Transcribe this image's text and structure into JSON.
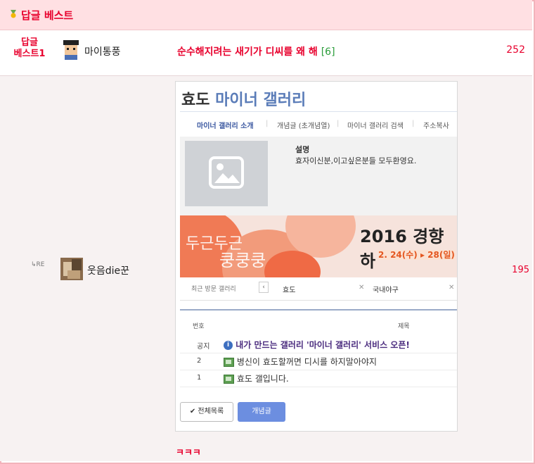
{
  "header": {
    "title": "답글 베스트"
  },
  "best_row": {
    "rank_line1": "답글",
    "rank_line2": "베스트1",
    "nickname": "마이통풍",
    "subject": "순수해지려는 새기가 디씨를 왜 해",
    "reply_count": "[6]",
    "score": "252"
  },
  "reply_row": {
    "re_label": "↳RE",
    "nickname": "웃음die꾼",
    "score": "195",
    "body_text": "ㅋㅋㅋ",
    "embedded": {
      "gallery_title_prefix": "효도",
      "gallery_title_accent": "마이너 갤러리",
      "nav": [
        "마이너 갤러리 소개",
        "개념글 (초개념열)",
        "마이너 갤러리 검색",
        "주소복사"
      ],
      "info_label": "설명",
      "info_desc": "효자이신분,이고싶은분들 모두환영요.",
      "banner_text1": "두근두근",
      "banner_text2": "쿵쿵쿵",
      "banner_title": "2016 경향하",
      "banner_dates": "2. 24(수) ▸ 28(일)",
      "recent_label": "최근 방문 갤러리",
      "recent_items": [
        "효도",
        "국내야구"
      ],
      "table_headers": [
        "번호",
        "제목"
      ],
      "rows": [
        {
          "num": "공지",
          "title": "내가 만드는 갤러리 '마이너 갤러리' 서비스 오픈!"
        },
        {
          "num": "2",
          "title": "병신이 효도할꺼면 디시를 하지말아야지"
        },
        {
          "num": "1",
          "title": "효도 갤입니다."
        }
      ],
      "btn_all": "전체목록",
      "btn_concept": "개념글"
    }
  },
  "colors": {
    "accent": "#e8002d",
    "header_bg": "#ffe0e3",
    "reply_count": "#2a9d3a"
  }
}
